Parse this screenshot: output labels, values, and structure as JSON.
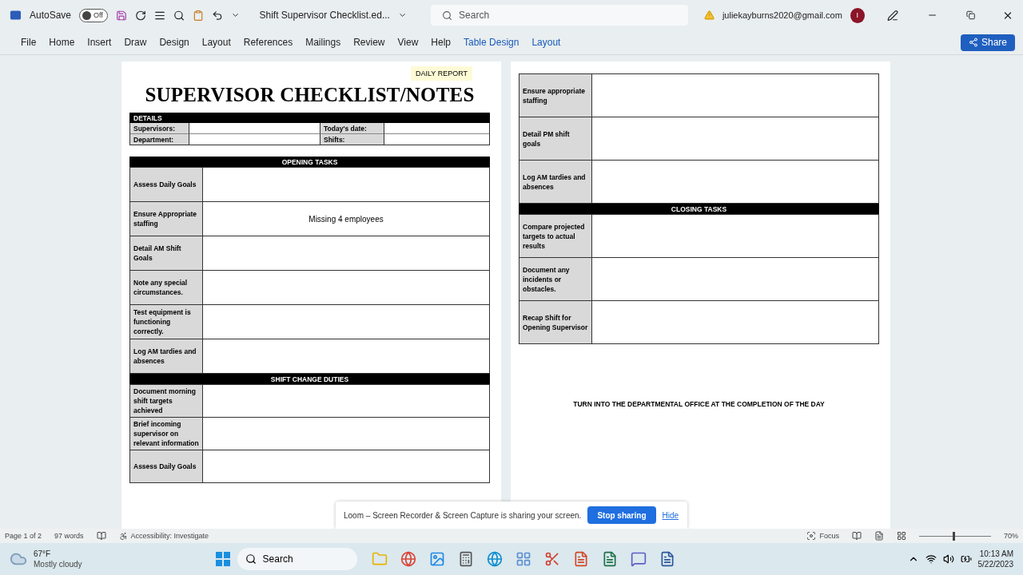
{
  "title_bar": {
    "autosave_label": "AutoSave",
    "autosave": {
      "label": "Off",
      "on": false
    },
    "document_title": "Shift Supervisor Checklist.ed...",
    "search": {
      "placeholder": "Search"
    },
    "account": "juliekayburns2020@gmail.com",
    "avatar_initial": "I"
  },
  "ribbon_tabs": [
    {
      "label": "File",
      "kind": "standard"
    },
    {
      "label": "Home",
      "kind": "standard"
    },
    {
      "label": "Insert",
      "kind": "standard"
    },
    {
      "label": "Draw",
      "kind": "standard"
    },
    {
      "label": "Design",
      "kind": "standard"
    },
    {
      "label": "Layout",
      "kind": "standard"
    },
    {
      "label": "References",
      "kind": "standard"
    },
    {
      "label": "Mailings",
      "kind": "standard"
    },
    {
      "label": "Review",
      "kind": "standard"
    },
    {
      "label": "View",
      "kind": "standard"
    },
    {
      "label": "Help",
      "kind": "standard"
    },
    {
      "label": "Table Design",
      "kind": "contextual"
    },
    {
      "label": "Layout",
      "kind": "contextual"
    }
  ],
  "share_button": "Share",
  "page_1": {
    "badge": "DAILY REPORT",
    "title": "SUPERVISOR CHECKLIST/NOTES",
    "details": {
      "header": "DETAILS",
      "rows": [
        {
          "label": "Supervisors:",
          "label_2": "Today's date:"
        },
        {
          "label": "Department:",
          "label_2": "Shifts:"
        }
      ]
    },
    "sections": [
      {
        "title": "OPENING TASKS",
        "rows": [
          {
            "task": "Assess Daily Goals"
          },
          {
            "task": "Ensure Appropriate staffing",
            "note": "Missing 4 employees"
          },
          {
            "task": "Detail AM Shift Goals"
          },
          {
            "task": "Note any special circumstances."
          },
          {
            "task": "Test equipment is functioning correctly."
          },
          {
            "task": "Log AM tardies and absences"
          }
        ]
      },
      {
        "title": "SHIFT CHANGE DUTIES",
        "rows": [
          {
            "task": "Document morning shift targets achieved"
          },
          {
            "task": "Brief incoming supervisor on relevant information"
          },
          {
            "task": "Assess Daily Goals"
          }
        ]
      }
    ]
  },
  "page_2": {
    "rows": [
      {
        "task": "Ensure appropriate staffing"
      },
      {
        "task": "Detail PM shift goals"
      },
      {
        "task": "Log AM tardies and absences"
      }
    ],
    "sections": [
      {
        "title": "CLOSING TASKS",
        "rows": [
          {
            "task": "Compare projected targets to actual results"
          },
          {
            "task": "Document any incidents or obstacles."
          },
          {
            "task": "Recap Shift for Opening Supervisor"
          }
        ]
      }
    ],
    "footer": "TURN INTO THE DEPARTMENTAL OFFICE AT THE COMPLETION OF THE DAY"
  },
  "sharing_bar": {
    "message": "Loom – Screen Recorder & Screen Capture is sharing your screen.",
    "stop_button": "Stop sharing",
    "hide_link": "Hide"
  },
  "status_bar": {
    "page": "Page 1 of 2",
    "words": "97 words",
    "accessibility": "Accessibility: Investigate",
    "focus": "Focus",
    "zoom": "70%",
    "zoom_slider": {
      "level": 0.47
    }
  },
  "taskbar": {
    "temperature": "67°F",
    "weather": "Mostly cloudy",
    "search": {
      "placeholder": "Search"
    },
    "time": "10:13 AM",
    "date": "5/22/2023"
  }
}
